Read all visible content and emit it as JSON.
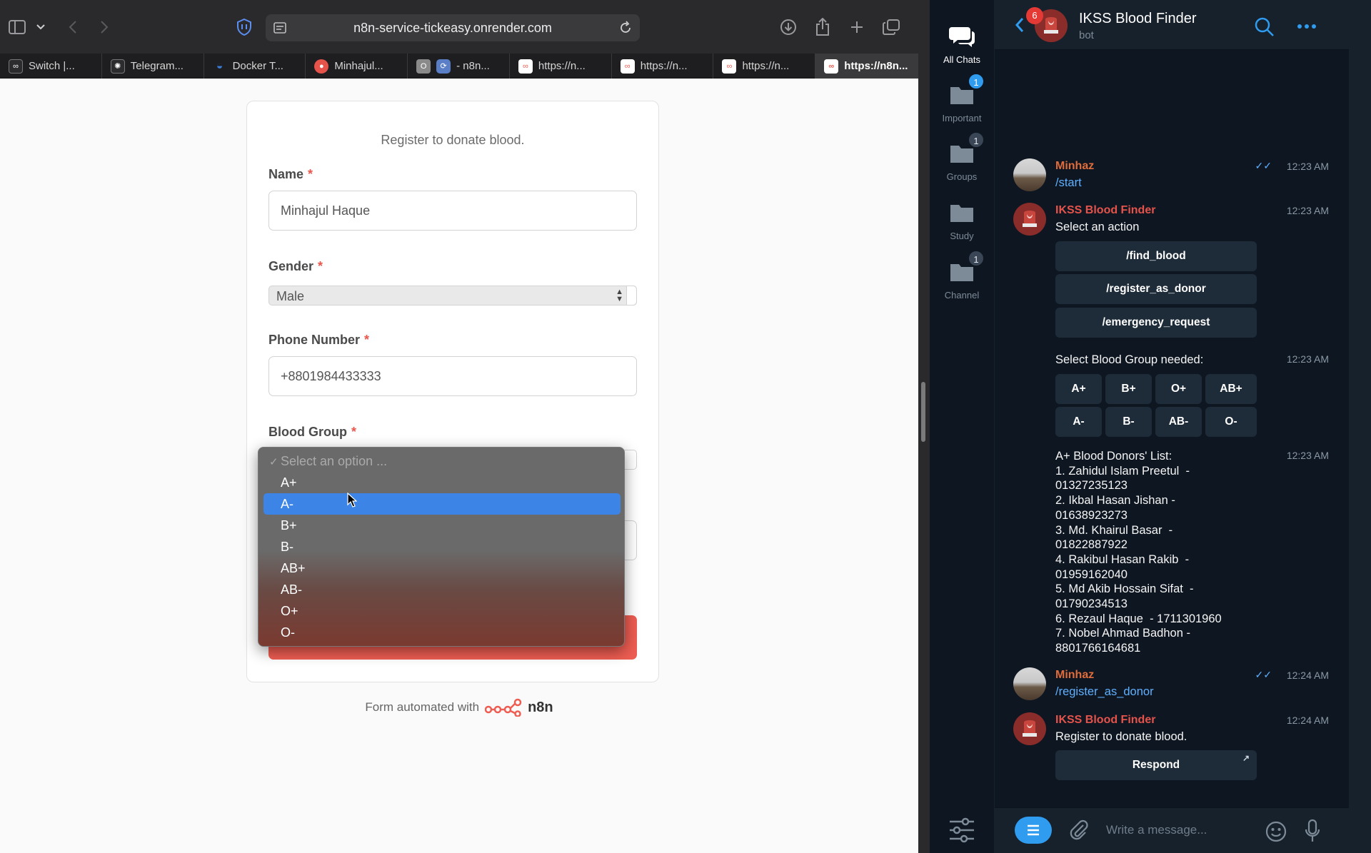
{
  "browser": {
    "url": "n8n-service-tickeasy.onrender.com",
    "tabs": [
      {
        "label": "Switch |...",
        "icon": "n8n-icon",
        "color": "#ffffff"
      },
      {
        "label": "Telegram...",
        "icon": "openai-icon",
        "color": "#ffffff"
      },
      {
        "label": "Docker T...",
        "icon": "docker-icon",
        "color": "#3a7bd5"
      },
      {
        "label": "Minhajul...",
        "icon": "avatar-icon",
        "color": "#e5534b"
      },
      {
        "label": "- n8n...",
        "icon": "o-icon",
        "color": "#8a8a8a"
      },
      {
        "label": "https://n...",
        "icon": "n8n-icon",
        "color": "#ffffff"
      },
      {
        "label": "https://n...",
        "icon": "n8n-icon",
        "color": "#ffffff"
      },
      {
        "label": "https://n...",
        "icon": "n8n-icon",
        "color": "#ffffff"
      },
      {
        "label": "https://n8n...",
        "icon": "n8n-icon",
        "color": "#ffffff"
      }
    ]
  },
  "form": {
    "subtitle": "Register to donate blood.",
    "fields": {
      "name": {
        "label": "Name",
        "required": "*",
        "value": "Minhajul Haque"
      },
      "gender": {
        "label": "Gender",
        "required": "*",
        "value": "Male"
      },
      "phone": {
        "label": "Phone Number",
        "required": "*",
        "value": "+8801984433333"
      },
      "blood_group": {
        "label": "Blood Group",
        "required": "*"
      }
    },
    "dropdown": {
      "placeholder": "Select an option ...",
      "check": "✓",
      "options": [
        "A+",
        "A-",
        "B+",
        "B-",
        "AB+",
        "AB-",
        "O+",
        "O-"
      ],
      "highlighted": "A-"
    },
    "footer_text": "Form automated with",
    "footer_brand": "n8n",
    "accent": "#ee5d52"
  },
  "telegram": {
    "folders": [
      {
        "label": "All Chats",
        "badge": ""
      },
      {
        "label": "Important",
        "badge": "1"
      },
      {
        "label": "Groups",
        "badge": "1"
      },
      {
        "label": "Study",
        "badge": ""
      },
      {
        "label": "Channel",
        "badge": "1"
      }
    ],
    "header": {
      "title": "IKSS Blood Finder",
      "subtitle": "bot",
      "back_badge": "6"
    },
    "messages": {
      "m1": {
        "sender": "Minhaz",
        "text": "/start",
        "time": "12:23 AM",
        "ticks": "✓✓"
      },
      "m2": {
        "sender": "IKSS Blood Finder",
        "text": "Select an action",
        "time": "12:23 AM",
        "buttons": [
          "/find_blood",
          "/register_as_donor",
          "/emergency_request"
        ]
      },
      "m3": {
        "text": "Select Blood Group needed:",
        "time": "12:23 AM",
        "buttons": [
          "A+",
          "B+",
          "O+",
          "AB+",
          "A-",
          "B-",
          "AB-",
          "O-"
        ]
      },
      "m4": {
        "text": "A+ Blood Donors' List:\n1. Zahidul Islam Preetul  -\n01327235123\n2. Ikbal Hasan Jishan -\n01638923273\n3. Md. Khairul Basar  -\n01822887922\n4. Rakibul Hasan Rakib  -\n01959162040\n5. Md Akib Hossain Sifat  -\n01790234513\n6. Rezaul Haque  - 1711301960\n7. Nobel Ahmad Badhon -\n8801766164681",
        "time": "12:23 AM"
      },
      "m5": {
        "sender": "Minhaz",
        "text": "/register_as_donor",
        "time": "12:24 AM",
        "ticks": "✓✓"
      },
      "m6": {
        "sender": "IKSS Blood Finder",
        "text": "Register to donate blood.",
        "time": "12:24 AM",
        "button": "Respond",
        "button_arrow": "↗"
      }
    },
    "composer": {
      "placeholder": "Write a message..."
    },
    "colors": {
      "accent": "#2f9cf0",
      "user_name": "#e06c3b",
      "bot_name": "#e5534b"
    }
  }
}
